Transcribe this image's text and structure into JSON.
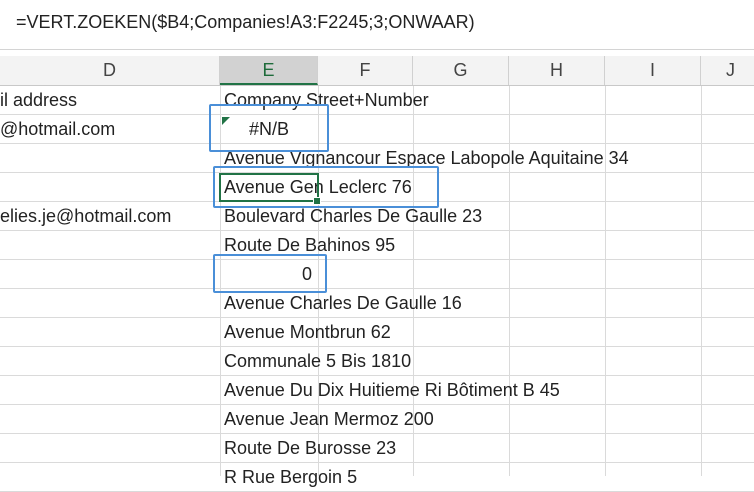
{
  "formula_bar": {
    "formula": "=VERT.ZOEKEN($B4;Companies!A3:F2245;3;ONWAAR)"
  },
  "columns": [
    "D",
    "E",
    "F",
    "G",
    "H",
    "I",
    "J"
  ],
  "rows": [
    {
      "d": "il address",
      "e": "Company Street+Number"
    },
    {
      "d": "@hotmail.com",
      "e": "#N/B"
    },
    {
      "d": "",
      "e": "Avenue Vignancour Espace Labopole Aquitaine 34"
    },
    {
      "d": "",
      "e": "Avenue Gen Leclerc 76"
    },
    {
      "d": "elies.je@hotmail.com",
      "e": "Boulevard Charles De Gaulle 23"
    },
    {
      "d": "",
      "e": "Route De Bahinos 95"
    },
    {
      "d": "",
      "e": "0"
    },
    {
      "d": "",
      "e": "Avenue Charles De Gaulle 16"
    },
    {
      "d": "",
      "e": "Avenue Montbrun 62"
    },
    {
      "d": "",
      "e": "Communale 5 Bis 1810"
    },
    {
      "d": "",
      "e": "Avenue Du Dix Huitieme Ri Bôtiment B 45"
    },
    {
      "d": "",
      "e": "Avenue Jean Mermoz 200"
    },
    {
      "d": "",
      "e": "Route De Burosse 23"
    },
    {
      "d": "",
      "e": "R Rue Bergoin 5"
    }
  ],
  "colors": {
    "accent_green": "#217346",
    "highlight_blue": "#4a8fd8"
  }
}
